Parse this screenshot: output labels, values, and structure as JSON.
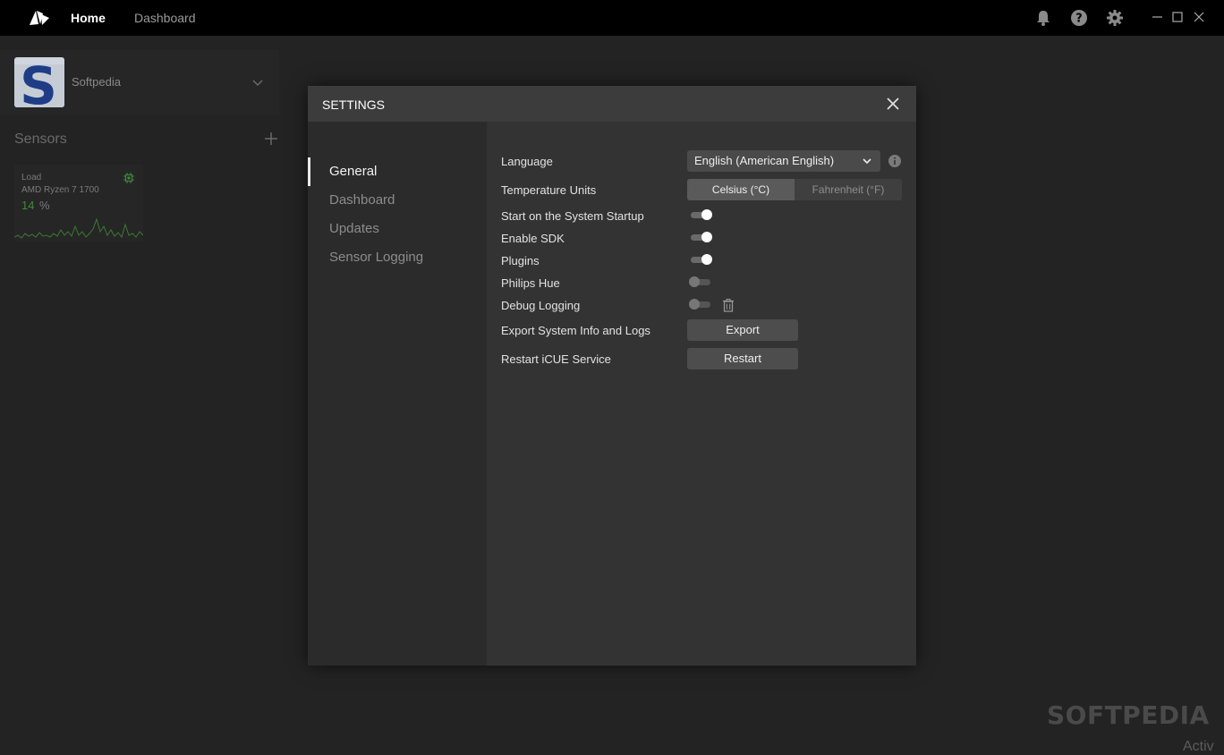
{
  "topbar": {
    "logo_icon": "corsair-sails-icon",
    "tabs": [
      {
        "label": "Home",
        "active": true
      },
      {
        "label": "Dashboard",
        "active": false
      }
    ],
    "icons": [
      "bell-icon",
      "help-icon",
      "gear-icon"
    ],
    "window_controls": [
      "minimize-icon",
      "maximize-icon",
      "close-icon"
    ]
  },
  "device": {
    "name": "Softpedia",
    "avatar_letter": "S"
  },
  "sensors": {
    "title": "Sensors",
    "card": {
      "label": "Load",
      "device": "AMD Ryzen 7 1700",
      "value": "14",
      "unit": "%"
    }
  },
  "settings": {
    "title": "SETTINGS",
    "nav": [
      {
        "label": "General",
        "active": true
      },
      {
        "label": "Dashboard",
        "active": false
      },
      {
        "label": "Updates",
        "active": false
      },
      {
        "label": "Sensor Logging",
        "active": false
      }
    ],
    "general": {
      "language_label": "Language",
      "language_value": "English (American English)",
      "temperature_label": "Temperature Units",
      "temp_options": [
        "Celsius (°C)",
        "Fahrenheit (°F)"
      ],
      "temp_selected": "Celsius (°C)",
      "toggles": [
        {
          "label": "Start on the System Startup",
          "on": true
        },
        {
          "label": "Enable SDK",
          "on": true
        },
        {
          "label": "Plugins",
          "on": true
        },
        {
          "label": "Philips Hue",
          "on": false
        },
        {
          "label": "Debug Logging",
          "on": false
        }
      ],
      "export_label": "Export System Info and Logs",
      "export_button": "Export",
      "restart_label": "Restart iCUE Service",
      "restart_button": "Restart"
    }
  },
  "watermark": {
    "text": "SOFTPEDIA",
    "sub": "Activ"
  },
  "colors": {
    "sensor_accent": "#3d8a35",
    "modal_header": "#3c3c3c",
    "background": "#232323"
  }
}
